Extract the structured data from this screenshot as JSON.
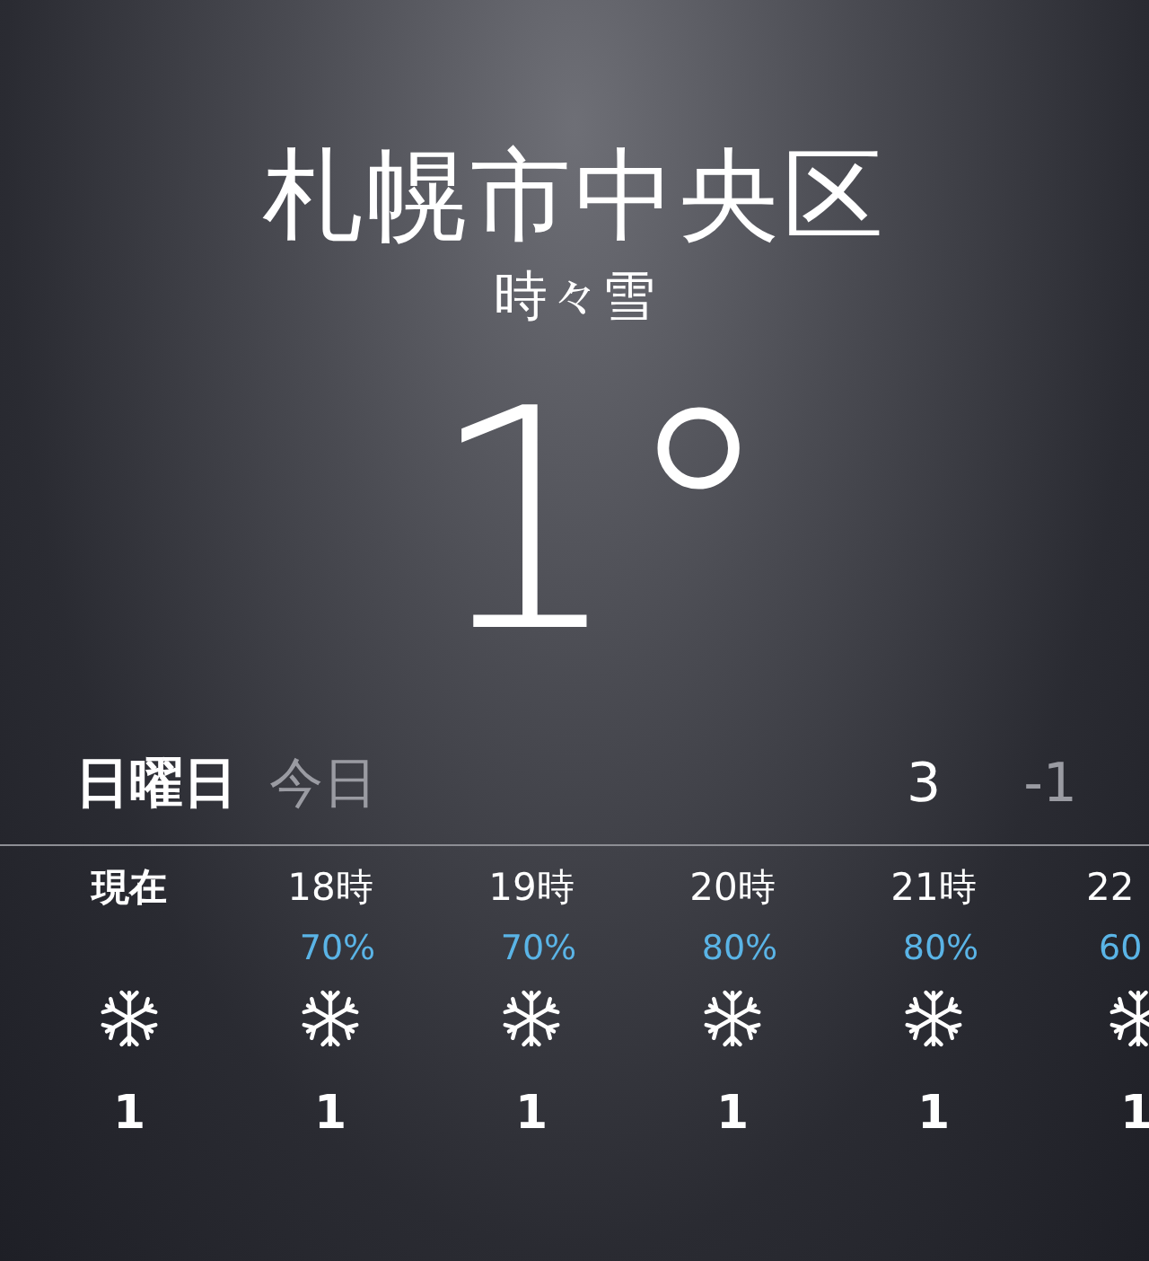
{
  "location": {
    "city": "札幌市中央区",
    "condition": "時々雪",
    "temperature": "1°"
  },
  "today": {
    "day": "日曜日",
    "label": "今日",
    "high": "3",
    "low": "-1"
  },
  "hourly": [
    {
      "time": "現在",
      "kind": "snow",
      "temp": "1"
    },
    {
      "time": "18時",
      "chance": "70%",
      "kind": "snow",
      "temp": "1"
    },
    {
      "time": "19時",
      "chance": "70%",
      "kind": "snow",
      "temp": "1"
    },
    {
      "time": "20時",
      "chance": "80%",
      "kind": "snow",
      "temp": "1"
    },
    {
      "time": "21時",
      "chance": "80%",
      "kind": "snow",
      "temp": "1"
    },
    {
      "time": "22",
      "chance": "60",
      "kind": "snow",
      "temp": "1"
    }
  ]
}
